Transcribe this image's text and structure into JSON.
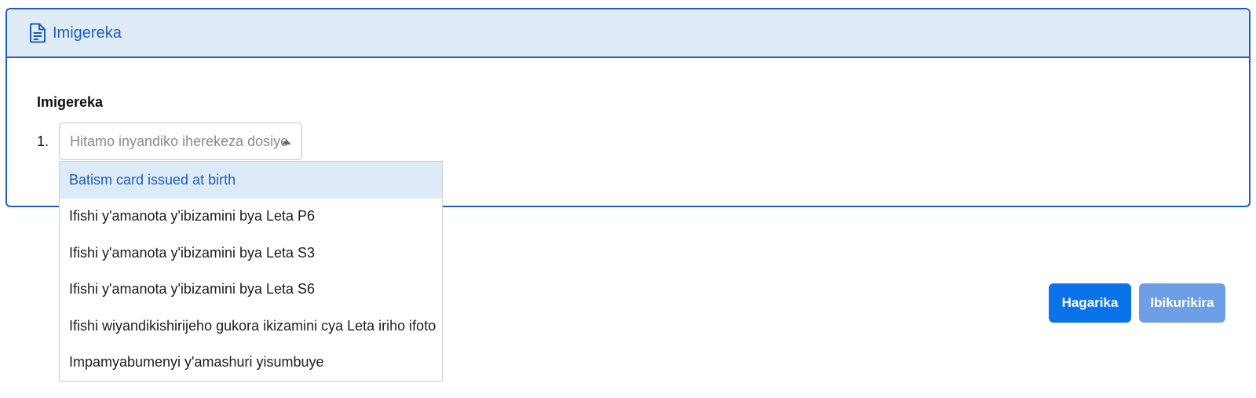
{
  "card": {
    "header_title": "Imigereka",
    "header_icon": "document-icon"
  },
  "form": {
    "field_label": "Imigereka",
    "item_number": "1.",
    "select": {
      "placeholder": "Hitamo inyandiko iherekeza dosiye",
      "expanded": true,
      "options": [
        {
          "label": "Batism card issued at birth",
          "highlighted": true
        },
        {
          "label": "Ifishi y'amanota y'ibizamini bya Leta P6",
          "highlighted": false
        },
        {
          "label": "Ifishi y'amanota y'ibizamini bya Leta S3",
          "highlighted": false
        },
        {
          "label": "Ifishi y'amanota y'ibizamini bya Leta S6",
          "highlighted": false
        },
        {
          "label": "Ifishi wiyandikishirijeho gukora ikizamini cya Leta iriho ifoto",
          "highlighted": false
        },
        {
          "label": "Impamyabumenyi y'amashuri yisumbuye",
          "highlighted": false
        }
      ]
    }
  },
  "actions": {
    "back_label": "Hagarika",
    "next_label": "Ibikurikira"
  },
  "colors": {
    "accent": "#1b5fc1",
    "header_bg": "#dfecf8",
    "primary_button": "#0a73ea",
    "disabled_button": "#6d9ee6"
  }
}
